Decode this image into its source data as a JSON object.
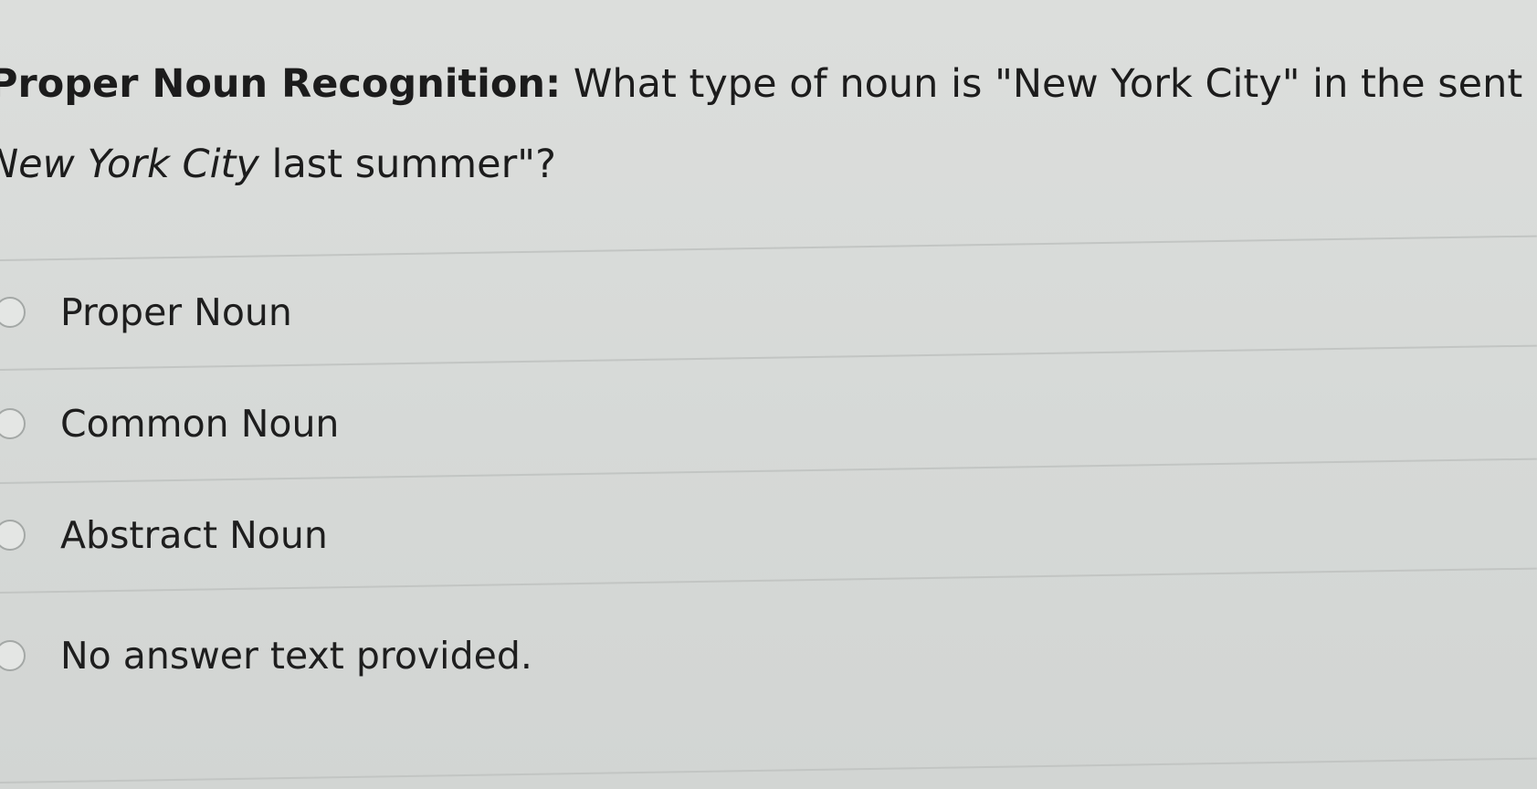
{
  "question": {
    "title": "Proper Noun Recognition:",
    "line1_text": " What type of noun is \"New York City\" in the sent",
    "line2_italic": "New York City",
    "line2_text": " last summer\"?"
  },
  "options": [
    {
      "label": "Proper Noun"
    },
    {
      "label": "Common Noun"
    },
    {
      "label": "Abstract Noun"
    },
    {
      "label": "No answer text provided."
    }
  ]
}
